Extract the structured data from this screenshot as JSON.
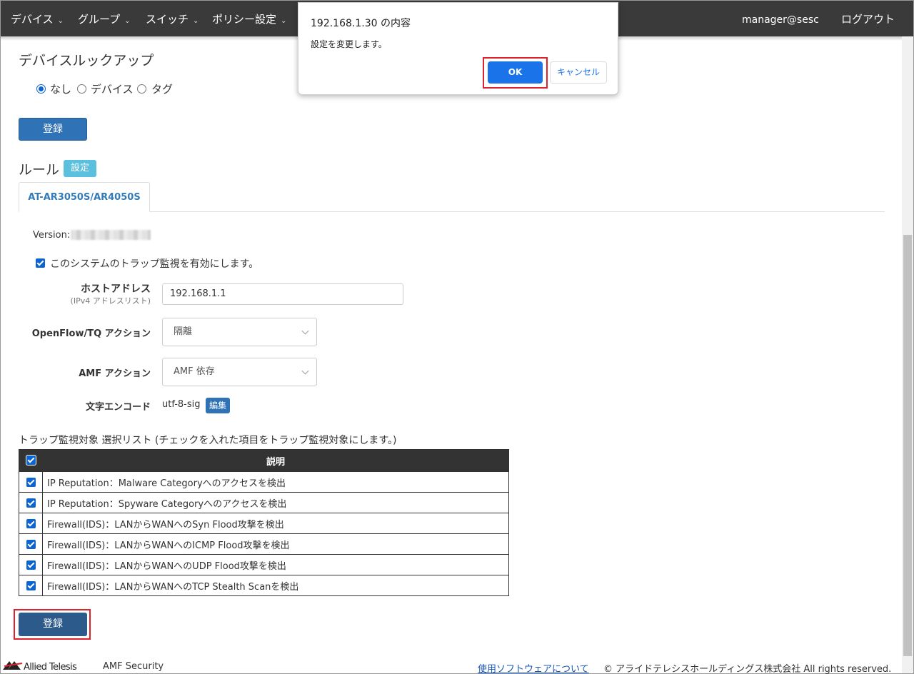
{
  "nav": {
    "items": [
      {
        "label": "デバイス"
      },
      {
        "label": "グループ"
      },
      {
        "label": "スイッチ"
      },
      {
        "label": "ポリシー設定"
      }
    ],
    "user": "manager@sesc",
    "logout": "ログアウト"
  },
  "device_lookup": {
    "title": "デバイスルックアップ",
    "options": [
      {
        "label": "なし",
        "checked": true
      },
      {
        "label": "デバイス",
        "checked": false
      },
      {
        "label": "タグ",
        "checked": false
      }
    ],
    "register": "登録"
  },
  "rules": {
    "title": "ルール",
    "settings_badge": "設定",
    "tab": "AT-AR3050S/AR4050S",
    "version_label": "Version:",
    "enable_trap": "このシステムのトラップ監視を有効にします。",
    "host_label": "ホストアドレス",
    "host_sub": "(IPv4 アドレスリスト)",
    "host_value": "192.168.1.1",
    "openflow_label": "OpenFlow/TQ アクション",
    "openflow_value": "隔離",
    "amf_label": "AMF アクション",
    "amf_value": "AMF 依存",
    "encoding_label": "文字エンコード",
    "encoding_value": "utf-8-sig",
    "edit": "編集",
    "list_caption": "トラップ監視対象 選択リスト (チェックを入れた項目をトラップ監視対象にします。)",
    "table_header": "説明",
    "rows": [
      "IP Reputation：Malware Categoryへのアクセスを検出",
      "IP Reputation：Spyware Categoryへのアクセスを検出",
      "Firewall(IDS)：LANからWANへのSyn Flood攻撃を検出",
      "Firewall(IDS)：LANからWANへのICMP Flood攻撃を検出",
      "Firewall(IDS)：LANからWANへのUDP Flood攻撃を検出",
      "Firewall(IDS)：LANからWANへのTCP Stealth Scanを検出"
    ],
    "register": "登録"
  },
  "footer": {
    "logo": "Allied Telesis",
    "product": "AMF Security",
    "link": "使用ソフトウェアについて",
    "copyright": "© アライドテレシスホールディングス株式会社 All rights reserved."
  },
  "dialog": {
    "title": "192.168.1.30 の内容",
    "message": "設定を変更します。",
    "ok": "OK",
    "cancel": "キャンセル"
  }
}
